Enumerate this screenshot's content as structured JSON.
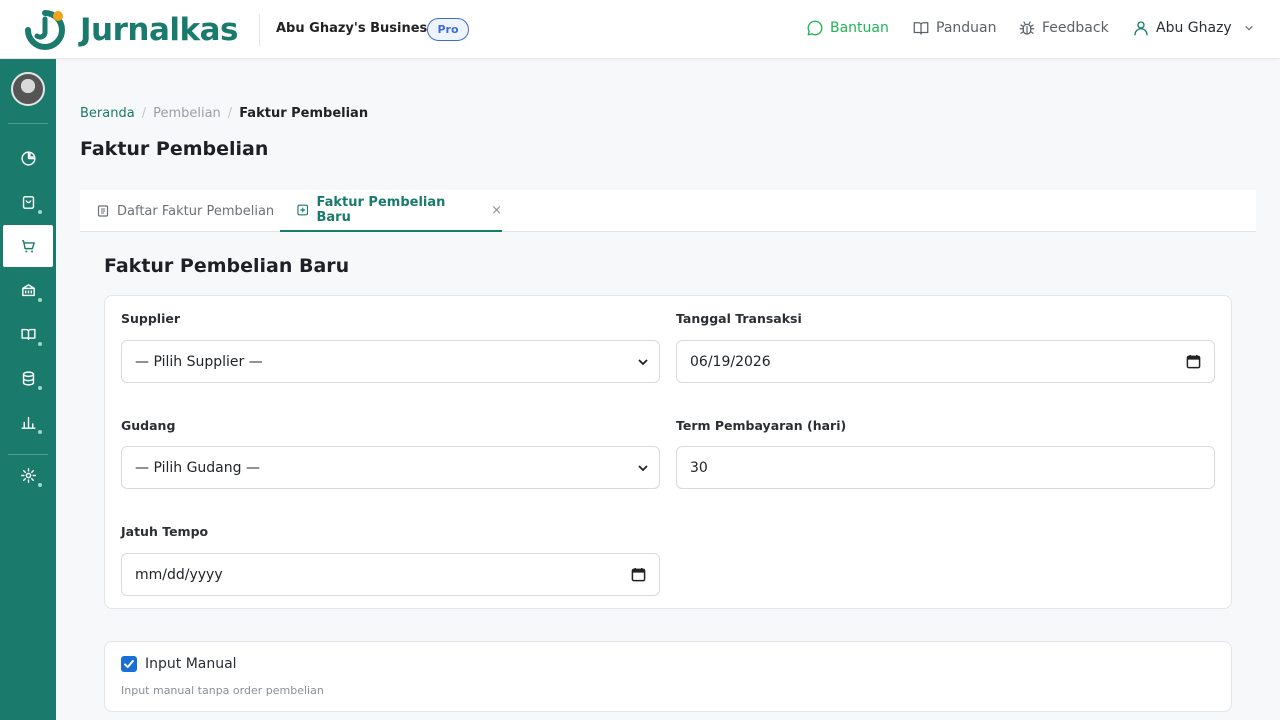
{
  "header": {
    "brand": "Jurnalkas",
    "business_name": "Abu Ghazy's Business",
    "plan_badge": "Pro",
    "nav": {
      "help": "Bantuan",
      "guide": "Panduan",
      "feedback": "Feedback",
      "user": "Abu Ghazy"
    }
  },
  "sidebar": {
    "items": [
      {
        "icon": "pie-chart-icon",
        "active": false
      },
      {
        "icon": "shopping-bag-icon",
        "active": false,
        "has_submenu": true
      },
      {
        "icon": "cart-icon",
        "active": true
      },
      {
        "icon": "bank-icon",
        "active": false,
        "has_submenu": true
      },
      {
        "icon": "book-icon",
        "active": false,
        "has_submenu": true
      },
      {
        "icon": "database-icon",
        "active": false,
        "has_submenu": true
      },
      {
        "icon": "bar-chart-icon",
        "active": false,
        "has_submenu": true
      },
      {
        "icon": "gear-icon",
        "active": false,
        "has_submenu": true
      }
    ]
  },
  "breadcrumb": {
    "home": "Beranda",
    "parent": "Pembelian",
    "current": "Faktur Pembelian"
  },
  "page_title": "Faktur Pembelian",
  "tabs": {
    "list_label": "Daftar Faktur Pembelian",
    "new_label": "Faktur Pembelian Baru",
    "close_glyph": "×"
  },
  "form": {
    "title": "Faktur Pembelian Baru",
    "supplier": {
      "label": "Supplier",
      "value": "— Pilih Supplier —"
    },
    "transaction_date": {
      "label": "Tanggal Transaksi",
      "value": "06/19/2026"
    },
    "warehouse": {
      "label": "Gudang",
      "value": "— Pilih Gudang —"
    },
    "payment_term": {
      "label": "Term Pembayaran (hari)",
      "value": "30"
    },
    "due_date": {
      "label": "Jatuh Tempo",
      "placeholder": "mm/dd/yyyy"
    },
    "manual_input": {
      "label": "Input Manual",
      "checked": true,
      "help": "Input manual tanpa order pembelian"
    }
  },
  "colors": {
    "brand": "#1a7a6c",
    "help_green": "#22b45a",
    "pro_blue": "#3b6fd4",
    "checkbox_blue": "#1a6fd6"
  }
}
